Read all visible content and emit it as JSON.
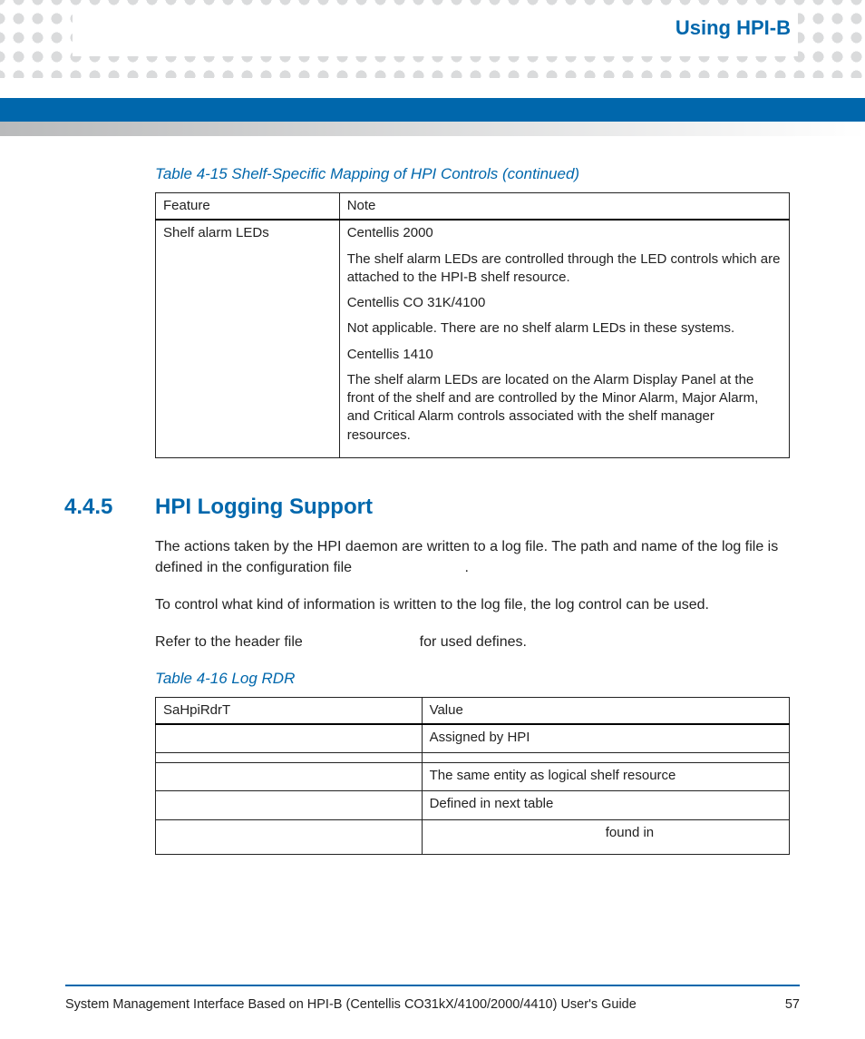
{
  "chapter_title": "Using HPI-B",
  "table415": {
    "caption": "Table 4-15 Shelf-Specific Mapping of HPI Controls (continued)",
    "head": {
      "c0": "Feature",
      "c1": "Note"
    },
    "row": {
      "feature": "Shelf alarm LEDs",
      "n1": "Centellis 2000",
      "n2": "The shelf alarm LEDs are controlled through the LED controls which are attached to the HPI-B shelf resource.",
      "n3": "Centellis CO 31K/4100",
      "n4": "Not applicable. There are no shelf alarm LEDs in these systems.",
      "n5": "Centellis 1410",
      "n6": "The shelf alarm LEDs are located on the Alarm Display Panel at the front of the shelf and are controlled by the Minor Alarm, Major Alarm, and Critical Alarm controls associated with the shelf manager resources."
    }
  },
  "section": {
    "num": "4.4.5",
    "title": "HPI Logging Support"
  },
  "para1a": "The actions taken by the HPI daemon are written to a log file. The path and name of the log file is defined in the configuration file ",
  "para1b": ".",
  "para2": "To control what kind of information is written to the log file, the log control can be used.",
  "para3a": "Refer to the header file ",
  "para3b": " for used defines.",
  "table416": {
    "caption": "Table 4-16 Log RDR",
    "head": {
      "c0": "SaHpiRdrT",
      "c1": "Value"
    },
    "rows": {
      "r0": {
        "c0": "",
        "c1": "Assigned by HPI"
      },
      "r1": {
        "c0": "",
        "c1": ""
      },
      "r2": {
        "c0": "",
        "c1": "The same entity as logical shelf resource"
      },
      "r3": {
        "c0": "",
        "c1": "Defined in next table"
      },
      "r4": {
        "c0": "",
        "c1_before": "",
        "c1_mid": "found in",
        "c1_after": ""
      }
    }
  },
  "footer": {
    "text": "System Management Interface Based on HPI-B (Centellis CO31kX/4100/2000/4410) User's Guide",
    "page": "57"
  }
}
